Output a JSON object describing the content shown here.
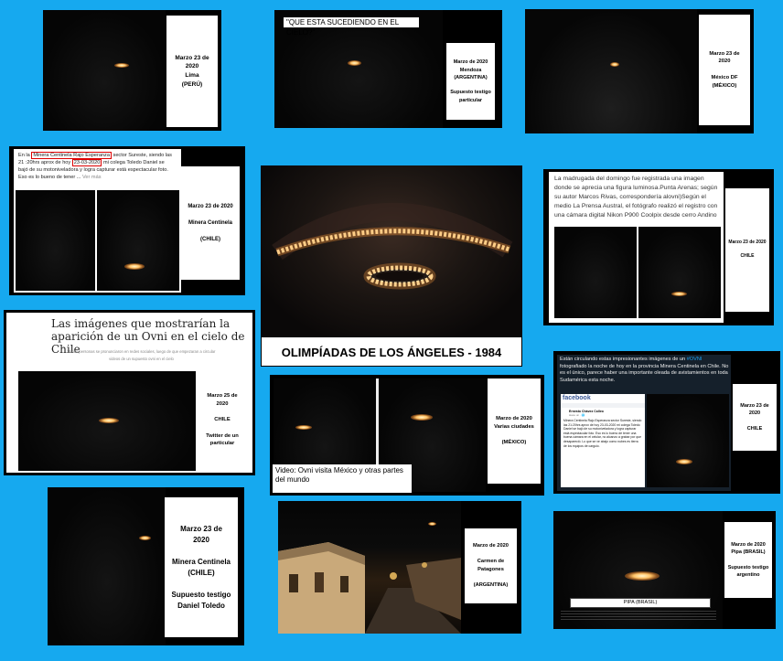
{
  "panels": {
    "p1": {
      "caption": [
        "Marzo 23 de",
        "2020",
        "Lima",
        "(PERÚ)"
      ]
    },
    "p2": {
      "header": "\"QUE ESTA SUCEDIENDO EN EL CIELO?\"",
      "caption": [
        "Marzo de 2020",
        "Mendoza",
        "(ARGENTINA)",
        "",
        "Supuesto testigo",
        "particular"
      ]
    },
    "p3": {
      "caption": [
        "Marzo 23 de",
        "2020",
        "",
        "México DF",
        "(MÉXICO)"
      ]
    },
    "p4": {
      "post_pre": "En la ",
      "post_hl1": "Minera Centinela Rajo Esperanza",
      "post_mid": " sector Sureste, siendo las 21 :20hrs aprox de hoy ",
      "post_hl2": "23-03-2020",
      "post_post": " mi colega Toledo Daniel se bajó de su motoniveladora y logra capturar está espectacular foto. Eso es lo bueno de tener ...",
      "post_more": "Ver más",
      "caption": [
        "Marzo 23 de 2020",
        "",
        "Minera Centinela",
        "",
        "(CHILE)"
      ]
    },
    "p5": {
      "title": "OLIMPÍADAS DE LOS ÁNGELES - 1984"
    },
    "p6": {
      "text": "La madrugada del domingo fue registrada una imagen donde se aprecia una figura luminosa.Punta Arenas; según su autor Marcos Rivas, correspondería alovni)Según el medio La Prensa Austral, el fotógrafo realizó el registro con una cámara digital Nikon P900 Coolpix desde cerro Andino",
      "caption": [
        "Marzo 23 de 2020",
        "",
        "CHILE"
      ]
    },
    "p7": {
      "headline": "Las imágenes que mostrarían la aparición de un Ovni en el cielo de Chile",
      "subtext": "Varias personas se pronunciaron en redes sociales, luego de que empezaran a circular videos de un supuesto ovni en el cielo",
      "caption": [
        "Marzo 25 de",
        "2020",
        "",
        "CHILE",
        "",
        "Twitter de un",
        "particular"
      ]
    },
    "p8": {
      "video_title": "Video: Ovni visita México y otras partes del mundo",
      "caption": [
        "Marzo de 2020",
        "Varias ciudades",
        "",
        "(MÉXICO)"
      ]
    },
    "p9": {
      "text": "Están circulando estas impresionantes imágenes de un ",
      "hashtag": "#OVNI",
      "text2": " fotografiado la noche de hoy en la provincia Minera Centinela en Chile. No es el único, parece haber una importante oleada de avistamientos en toda Sudamérica esta noche.",
      "fb_logo": "facebook",
      "fb_name": "Ernesto Chávez Colleo",
      "fb_meta": "Hace un · 🌐",
      "fb_post": "Minera Centinela Rajo Esperanza sector Sureste, siendo las 21:20hrs aprox de hoy 23-03-2020 mi colega Toledo Daniel se bajó de su motoniveladora y logra capturar está espectacular foto. Eso es lo bueno de tener una buena cámara en el celular, no alcanzo a grabar por que desapareció. Lo que se ve abajo como nubes es tierra de los equipos de carguio.",
      "caption": [
        "Marzo 23 de",
        "2020",
        "",
        "CHILE"
      ]
    },
    "p10": {
      "caption": [
        "Marzo 23 de",
        "2020",
        "",
        "Minera Centinela",
        "(CHILE)",
        "",
        "Supuesto testigo",
        "Daniel Toledo"
      ]
    },
    "p11": {
      "caption": [
        "Marzo de 2020",
        "",
        "Carmen de",
        "Patagones",
        "",
        "(ARGENTINA)"
      ]
    },
    "p12": {
      "label": "PIPA (BRASIL)",
      "caption": [
        "Marzo de 2020",
        "Pipa (BRASIL)",
        "",
        "Supuesto testigo",
        "argentino"
      ]
    }
  },
  "colors": {
    "background": "#16a9ef",
    "facebook": "#3b5998",
    "highlight": "#d00000"
  }
}
